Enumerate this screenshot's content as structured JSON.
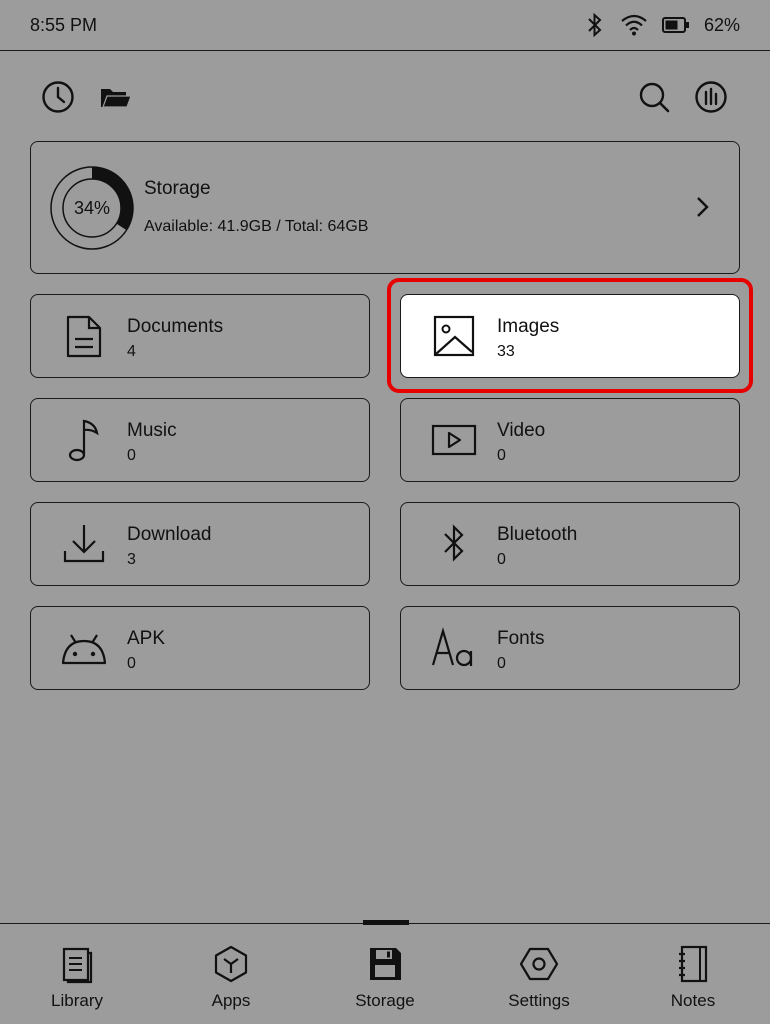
{
  "status": {
    "time": "8:55 PM",
    "battery": "62%"
  },
  "storage": {
    "title": "Storage",
    "percent_label": "34%",
    "percent": 0.34,
    "available": "Available: 41.9GB / Total: 64GB"
  },
  "tiles": [
    {
      "label": "Documents",
      "count": "4",
      "icon": "document-icon"
    },
    {
      "label": "Images",
      "count": "33",
      "icon": "image-icon"
    },
    {
      "label": "Music",
      "count": "0",
      "icon": "music-note-icon"
    },
    {
      "label": "Video",
      "count": "0",
      "icon": "video-icon"
    },
    {
      "label": "Download",
      "count": "3",
      "icon": "download-icon"
    },
    {
      "label": "Bluetooth",
      "count": "0",
      "icon": "bluetooth-icon"
    },
    {
      "label": "APK",
      "count": "0",
      "icon": "android-icon"
    },
    {
      "label": "Fonts",
      "count": "0",
      "icon": "fonts-icon"
    }
  ],
  "nav": [
    {
      "label": "Library",
      "icon": "library-icon"
    },
    {
      "label": "Apps",
      "icon": "apps-icon"
    },
    {
      "label": "Storage",
      "icon": "storage-icon"
    },
    {
      "label": "Settings",
      "icon": "settings-icon"
    },
    {
      "label": "Notes",
      "icon": "notes-icon"
    }
  ],
  "colors": {
    "background": "#9c9c9c",
    "selected_tile": "#ffffff",
    "highlight": "#e60000",
    "ink": "#111111"
  }
}
